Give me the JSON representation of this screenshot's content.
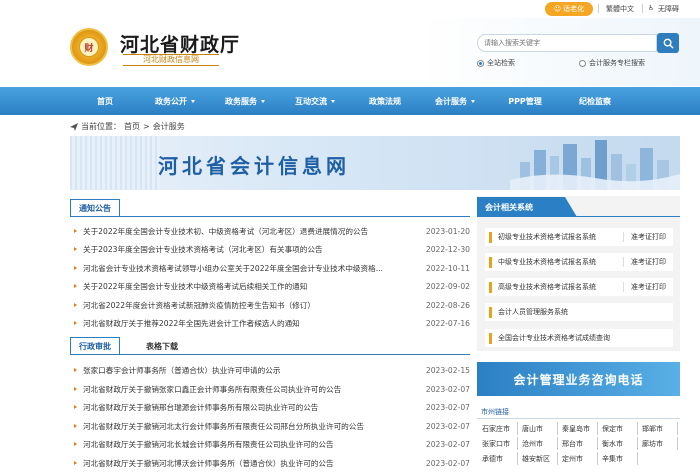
{
  "topbar": {
    "care_label": "适老化",
    "traditional_label": "繁體中文",
    "accessibility_label": "无障碍"
  },
  "header": {
    "title": "河北省财政厅",
    "subtitle": "河北财政信息网",
    "emblem_char": "财"
  },
  "search": {
    "placeholder": "请输入搜索关键字",
    "options": [
      "全站检索",
      "会计服务专栏搜索"
    ]
  },
  "nav": {
    "items": [
      {
        "label": "首页",
        "has_dropdown": false
      },
      {
        "label": "政务公开",
        "has_dropdown": true
      },
      {
        "label": "政务服务",
        "has_dropdown": true
      },
      {
        "label": "互动交流",
        "has_dropdown": true
      },
      {
        "label": "政策法规",
        "has_dropdown": false
      },
      {
        "label": "会计服务",
        "has_dropdown": true
      },
      {
        "label": "PPP管理",
        "has_dropdown": false
      },
      {
        "label": "纪检监察",
        "has_dropdown": false
      }
    ]
  },
  "breadcrumb": {
    "prefix": "当前位置：",
    "home": "首页",
    "sep": " > ",
    "current": "会计服务"
  },
  "banner": {
    "title": "河北省会计信息网"
  },
  "notices": {
    "tab": "通知公告",
    "items": [
      {
        "title": "关于2022年度全国会计专业技术初、中级资格考试（河北考区）退费进展情况的公告",
        "date": "2023-01-20"
      },
      {
        "title": "关于2023年度全国会计专业技术资格考试（河北考区）有关事项的公告",
        "date": "2022-12-30"
      },
      {
        "title": "河北省会计专业技术资格考试领导小组办公室关于2022年度全国会计专业技术中级资格...",
        "date": "2022-10-11"
      },
      {
        "title": "关于2022年度全国会计专业技术中级资格考试后续相关工作的通知",
        "date": "2022-09-02"
      },
      {
        "title": "河北省2022年度会计资格考试新冠肺炎疫情防控考生告知书（修订）",
        "date": "2022-08-26"
      },
      {
        "title": "河北省财政厅关于推荐2022年全国先进会计工作者候选人的通知",
        "date": "2022-07-16"
      }
    ]
  },
  "approvals": {
    "tabs": [
      "行政审批",
      "表格下载"
    ],
    "items": [
      {
        "title": "张家口春宇会计师事务所（普通合伙）执业许可申请的公示",
        "date": "2023-02-15"
      },
      {
        "title": "河北省财政厅关于撤销张家口鑫正会计师事务所有限责任公司执业许可的公告",
        "date": "2023-02-07"
      },
      {
        "title": "河北省财政厅关于撤销邢台瑞源会计师事务所有限公司执业许可的公告",
        "date": "2023-02-07"
      },
      {
        "title": "河北省财政厅关于撤销河北太行会计师事务所有限责任公司邢台分所执业许可的公告",
        "date": "2023-02-07"
      },
      {
        "title": "河北省财政厅关于撤销河北长城会计师事务所有限责任公司执业许可的公告",
        "date": "2023-02-07"
      },
      {
        "title": "河北省财政厅关于撤销河北博沃会计师事务所（普通合伙）执业许可的公告",
        "date": "2023-02-07"
      }
    ]
  },
  "sidebar": {
    "title": "会计相关系统",
    "items": [
      {
        "label": "初级专业技术资格考试报名系统",
        "extra": "准考证打印"
      },
      {
        "label": "中级专业技术资格考试报名系统",
        "extra": "准考证打印"
      },
      {
        "label": "高级专业技术资格考试报名系统",
        "extra": "准考证打印"
      },
      {
        "label": "会计人员管理服务系统",
        "extra": ""
      },
      {
        "label": "全国会计专业技术资格考试成绩查询",
        "extra": ""
      }
    ],
    "consult_label": "会计管理业务咨询电话"
  },
  "city_links": {
    "title": "市州链接",
    "cities": [
      "石家庄市",
      "唐山市",
      "秦皇岛市",
      "保定市",
      "邯郸市",
      "张家口市",
      "沧州市",
      "邢台市",
      "衡水市",
      "廊坊市",
      "承德市",
      "雄安新区",
      "定州市",
      "辛集市"
    ]
  },
  "colors": {
    "nav_blue": "#2b7fc4",
    "accent_orange": "#f5a623",
    "bullet_orange": "#e07a1a",
    "title_blue": "#1f5fa5"
  }
}
